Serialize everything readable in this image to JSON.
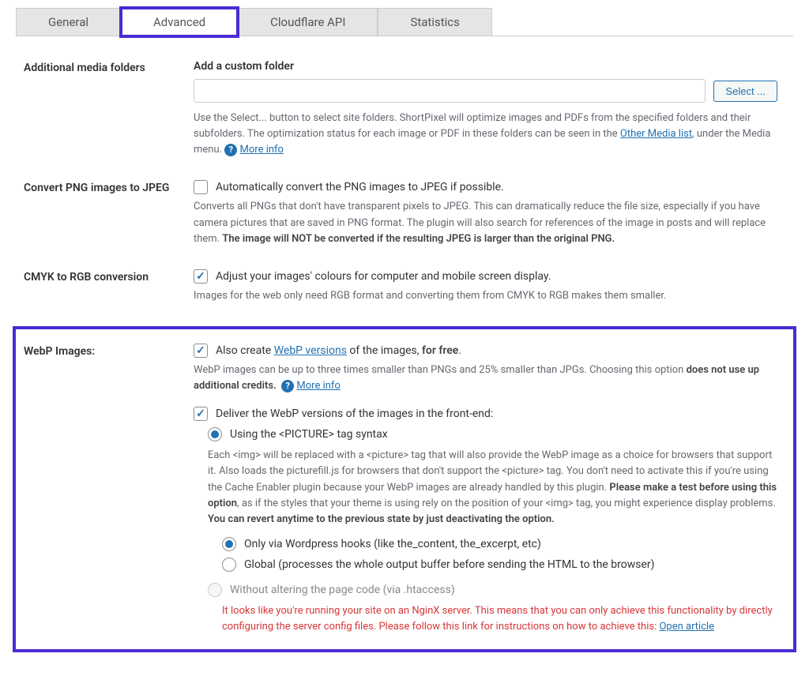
{
  "tabs": {
    "general": "General",
    "advanced": "Advanced",
    "cloudflare": "Cloudflare API",
    "statistics": "Statistics"
  },
  "sections": {
    "addFolders": {
      "label": "Additional media folders",
      "heading": "Add a custom folder",
      "selectBtn": "Select ...",
      "desc1": "Use the Select... button to select site folders. ShortPixel will optimize images and PDFs from the specified folders and their subfolders. The optimization status for each image or PDF in these folders can be seen in the ",
      "otherMedia": "Other Media list",
      "desc2": ", under the Media menu.  ",
      "moreInfo": "More info"
    },
    "png2jpeg": {
      "label": "Convert PNG images to JPEG",
      "cbLabel": "Automatically convert the PNG images to JPEG if possible.",
      "desc1": "Converts all PNGs that don't have transparent pixels to JPEG. This can dramatically reduce the file size, especially if you have camera pictures that are saved in PNG format. The plugin will also search for references of the image in posts and will replace them. ",
      "descBold": "The image will NOT be converted if the resulting JPEG is larger than the original PNG."
    },
    "cmyk": {
      "label": "CMYK to RGB conversion",
      "cbLabel": "Adjust your images' colours for computer and mobile screen display.",
      "desc": "Images for the web only need RGB format and converting them from CMYK to RGB makes them smaller."
    },
    "webp": {
      "label": "WebP Images:",
      "cb1_pre": "Also create ",
      "cb1_link": "WebP versions",
      "cb1_mid": " of the images, ",
      "cb1_bold": "for free",
      "cb1_end": ".",
      "desc1a": "WebP images can be up to three times smaller than PNGs and 25% smaller than JPGs. Choosing this option ",
      "desc1b": "does not use up additional credits.",
      "moreInfo": "More info",
      "cb2": "Deliver the WebP versions of the images in the front-end:",
      "r1": "Using the <PICTURE> tag syntax",
      "r1_desc_a": "Each <img> will be replaced with a <picture> tag that will also provide the WebP image as a choice for browsers that support it. Also loads the picturefill.js for browsers that don't support the <picture> tag. You don't need to activate this if you're using the Cache Enabler plugin because your WebP images are already handled by this plugin. ",
      "r1_desc_b": "Please make a test before using this option",
      "r1_desc_c": ", as if the styles that your theme is using rely on the position of your <img> tag, you might experience display problems. ",
      "r1_desc_d": "You can revert anytime to the previous state by just deactivating the option.",
      "r1a": "Only via Wordpress hooks (like the_content, the_excerpt, etc)",
      "r1b": "Global (processes the whole output buffer before sending the HTML to the browser)",
      "r2": "Without altering the page code (via .htaccess)",
      "warn": "It looks like you're running your site on an NginX server. This means that you can only achieve this functionality by directly configuring the server config files. Please follow this link for instructions on how to achieve this: ",
      "warnLink": "Open article"
    }
  }
}
